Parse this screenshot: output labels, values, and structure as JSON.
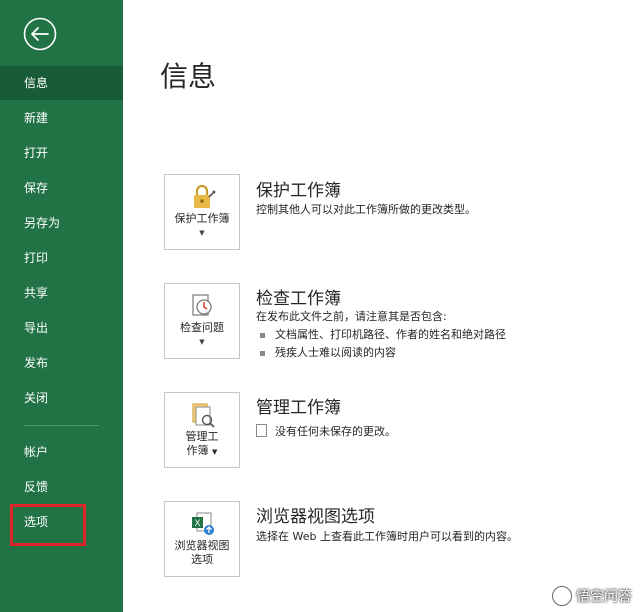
{
  "sidebar": {
    "items": [
      {
        "label": "信息",
        "active": true
      },
      {
        "label": "新建"
      },
      {
        "label": "打开"
      },
      {
        "label": "保存"
      },
      {
        "label": "另存为"
      },
      {
        "label": "打印"
      },
      {
        "label": "共享"
      },
      {
        "label": "导出"
      },
      {
        "label": "发布"
      },
      {
        "label": "关闭"
      },
      {
        "label": "帐户"
      },
      {
        "label": "反馈"
      },
      {
        "label": "选项"
      }
    ]
  },
  "main": {
    "title": "信息",
    "sections": [
      {
        "button_label": "保护工作簿",
        "title": "保护工作簿",
        "description": "控制其他人可以对此工作簿所做的更改类型。"
      },
      {
        "button_label": "检查问题",
        "title": "检查工作簿",
        "description": "在发布此文件之前，请注意其是否包含:",
        "bullets": [
          "文档属性、打印机路径、作者的姓名和绝对路径",
          "残疾人士难以阅读的内容"
        ]
      },
      {
        "button_label_line1": "管理工",
        "button_label_line2": "作簿",
        "title": "管理工作簿",
        "description": "没有任何未保存的更改。"
      },
      {
        "button_label_line1": "浏览器视图",
        "button_label_line2": "选项",
        "title": "浏览器视图选项",
        "description": "选择在 Web 上查看此工作簿时用户可以看到的内容。"
      }
    ]
  },
  "watermark": "悟空问答",
  "colors": {
    "sidebar": "#217346",
    "sidebar_active": "#185c37",
    "highlight": "#e0252a"
  }
}
